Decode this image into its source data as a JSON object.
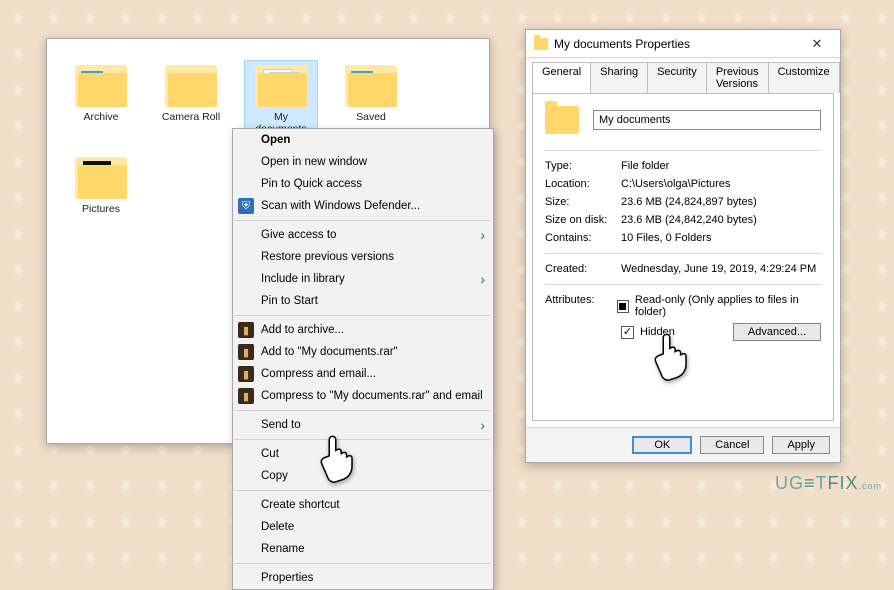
{
  "explorer": {
    "folders": [
      {
        "label": "Archive",
        "variant": "ps",
        "selected": false
      },
      {
        "label": "Camera Roll",
        "variant": "plain",
        "selected": false
      },
      {
        "label": "My documents",
        "variant": "sheets",
        "selected": true
      },
      {
        "label": "Saved",
        "variant": "ps",
        "selected": false
      },
      {
        "label": "Pictures",
        "variant": "dark",
        "selected": false
      }
    ]
  },
  "context_menu": {
    "open": "Open",
    "open_new_window": "Open in new window",
    "pin_quick_access": "Pin to Quick access",
    "scan_defender": "Scan with Windows Defender...",
    "give_access_to": "Give access to",
    "restore_previous": "Restore previous versions",
    "include_in_library": "Include in library",
    "pin_to_start": "Pin to Start",
    "add_to_archive": "Add to archive...",
    "add_to_rar": "Add to \"My documents.rar\"",
    "compress_email": "Compress and email...",
    "compress_rar_email": "Compress to \"My documents.rar\" and email",
    "send_to": "Send to",
    "cut": "Cut",
    "copy": "Copy",
    "create_shortcut": "Create shortcut",
    "delete": "Delete",
    "rename": "Rename",
    "properties": "Properties"
  },
  "properties": {
    "title": "My documents Properties",
    "tabs": {
      "general": "General",
      "sharing": "Sharing",
      "security": "Security",
      "previous_versions": "Previous Versions",
      "customize": "Customize"
    },
    "name_value": "My documents",
    "rows": {
      "type_k": "Type:",
      "type_v": "File folder",
      "location_k": "Location:",
      "location_v": "C:\\Users\\olga\\Pictures",
      "size_k": "Size:",
      "size_v": "23.6 MB (24,824,897 bytes)",
      "size_on_disk_k": "Size on disk:",
      "size_on_disk_v": "23.6 MB (24,842,240 bytes)",
      "contains_k": "Contains:",
      "contains_v": "10 Files, 0 Folders",
      "created_k": "Created:",
      "created_v": "Wednesday, June 19, 2019, 4:29:24 PM",
      "attributes_k": "Attributes:"
    },
    "readonly_label": "Read-only (Only applies to files in folder)",
    "hidden_label": "Hidden",
    "advanced_btn": "Advanced...",
    "ok": "OK",
    "cancel": "Cancel",
    "apply": "Apply"
  },
  "watermark": "UG≡TFIX"
}
